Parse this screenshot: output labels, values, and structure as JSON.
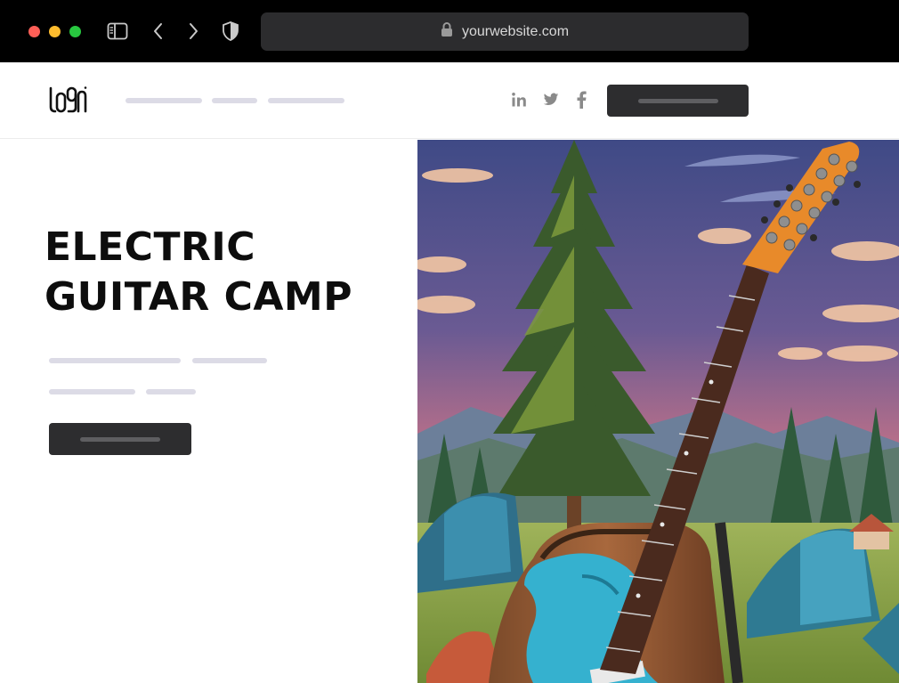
{
  "browser": {
    "url": "yourwebsite.com",
    "traffic_lights": {
      "close": "#ff5f57",
      "minimize": "#febc2e",
      "zoom": "#28c840"
    },
    "icons": [
      "sidebar-toggle-icon",
      "back-chevron-icon",
      "forward-chevron-icon",
      "shield-icon",
      "lock-icon"
    ]
  },
  "header": {
    "logo_icon": "logo-wordmark-icon",
    "social_icons": [
      "linkedin-icon",
      "twitter-icon",
      "facebook-icon"
    ]
  },
  "hero": {
    "title_line1": "ELECTRIC",
    "title_line2": "GUITAR CAMP",
    "image_icon": "guitar-camp-illustration"
  },
  "colors": {
    "button_dark": "#2d2d2f",
    "placeholder_line": "#dcdbe6",
    "title": "#0d0d0d"
  }
}
